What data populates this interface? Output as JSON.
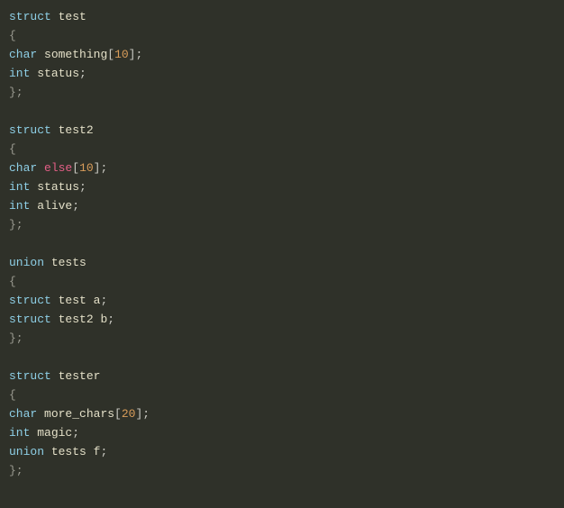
{
  "code": {
    "struct_kw": "struct",
    "union_kw": "union",
    "char_kw": "char",
    "int_kw": "int",
    "else_kw": "else",
    "obrace": "{",
    "cbrace": "};",
    "obrkt": "[",
    "cbrkt": "]",
    "semi": ";",
    "space": " ",
    "test": "test",
    "test2": "test2",
    "tests": "tests",
    "tester": "tester",
    "something": "something",
    "status": "status",
    "alive": "alive",
    "a": "a",
    "b": "b",
    "more_chars": "more_chars",
    "magic": "magic",
    "f": "f",
    "n10": "10",
    "n20": "20"
  }
}
